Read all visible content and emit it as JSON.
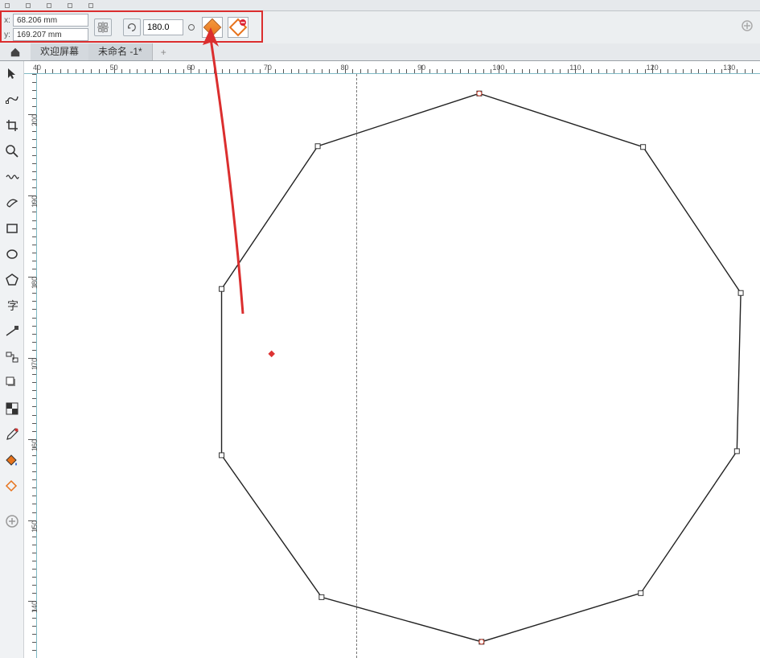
{
  "coords": {
    "x_label": "x:",
    "x_value": "68.206 mm",
    "y_label": "y:",
    "y_value": "169.207 mm"
  },
  "angle": {
    "value": "180.0"
  },
  "tabs": {
    "welcome": "欢迎屏幕",
    "file": "未命名 -1*",
    "add": "+"
  },
  "ruler_h": {
    "labels": [
      "40",
      "50",
      "60",
      "70",
      "80",
      "90",
      "100",
      "110",
      "120",
      "130"
    ],
    "start": 40,
    "end": 134,
    "major_interval": 10
  },
  "ruler_v": {
    "labels": [
      "200",
      "190",
      "180",
      "170",
      "160",
      "150",
      "140"
    ],
    "start": 205,
    "end": 133,
    "major_interval": 10
  },
  "guideline_x_mm": 81.5,
  "shape": {
    "center": {
      "x_mm": 97.5,
      "y_mm": 169.2
    },
    "node_mm": [
      [
        97.5,
        202.6
      ],
      [
        76.5,
        196.1
      ],
      [
        64.0,
        178.5
      ],
      [
        64.0,
        158.0
      ],
      [
        77.0,
        140.5
      ],
      [
        97.8,
        135.0
      ],
      [
        118.5,
        141.0
      ],
      [
        131.0,
        158.5
      ],
      [
        131.5,
        178.0
      ],
      [
        118.8,
        196.0
      ]
    ],
    "red_dot_mm": [
      70.5,
      170.5
    ]
  }
}
